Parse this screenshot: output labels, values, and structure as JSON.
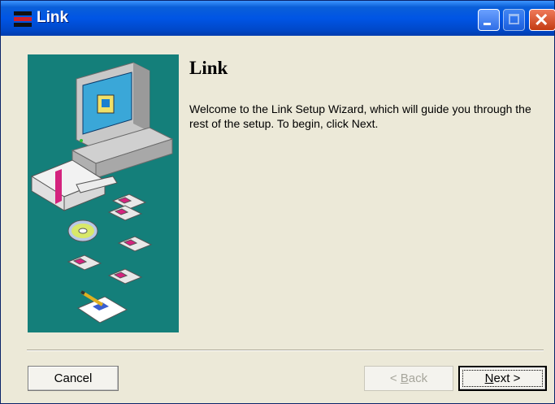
{
  "window": {
    "title": "Link",
    "minimize": "minimize",
    "maximize": "maximize",
    "close": "close"
  },
  "content": {
    "heading": "Link",
    "welcome": "Welcome to the Link Setup Wizard, which will guide you through the rest of the setup. To begin, click Next."
  },
  "buttons": {
    "cancel": "Cancel",
    "back_prefix": "< ",
    "back_key": "B",
    "back_rest": "ack",
    "next_key": "N",
    "next_rest": "ext >"
  },
  "colors": {
    "titlebar": "#0055e5",
    "panel": "#147f7a",
    "dialog_bg": "#ece9d8"
  },
  "icons": [
    "app-icon",
    "computer-illustration",
    "cd-icon",
    "floppy-disk-icon",
    "pencil-paper-icon"
  ]
}
